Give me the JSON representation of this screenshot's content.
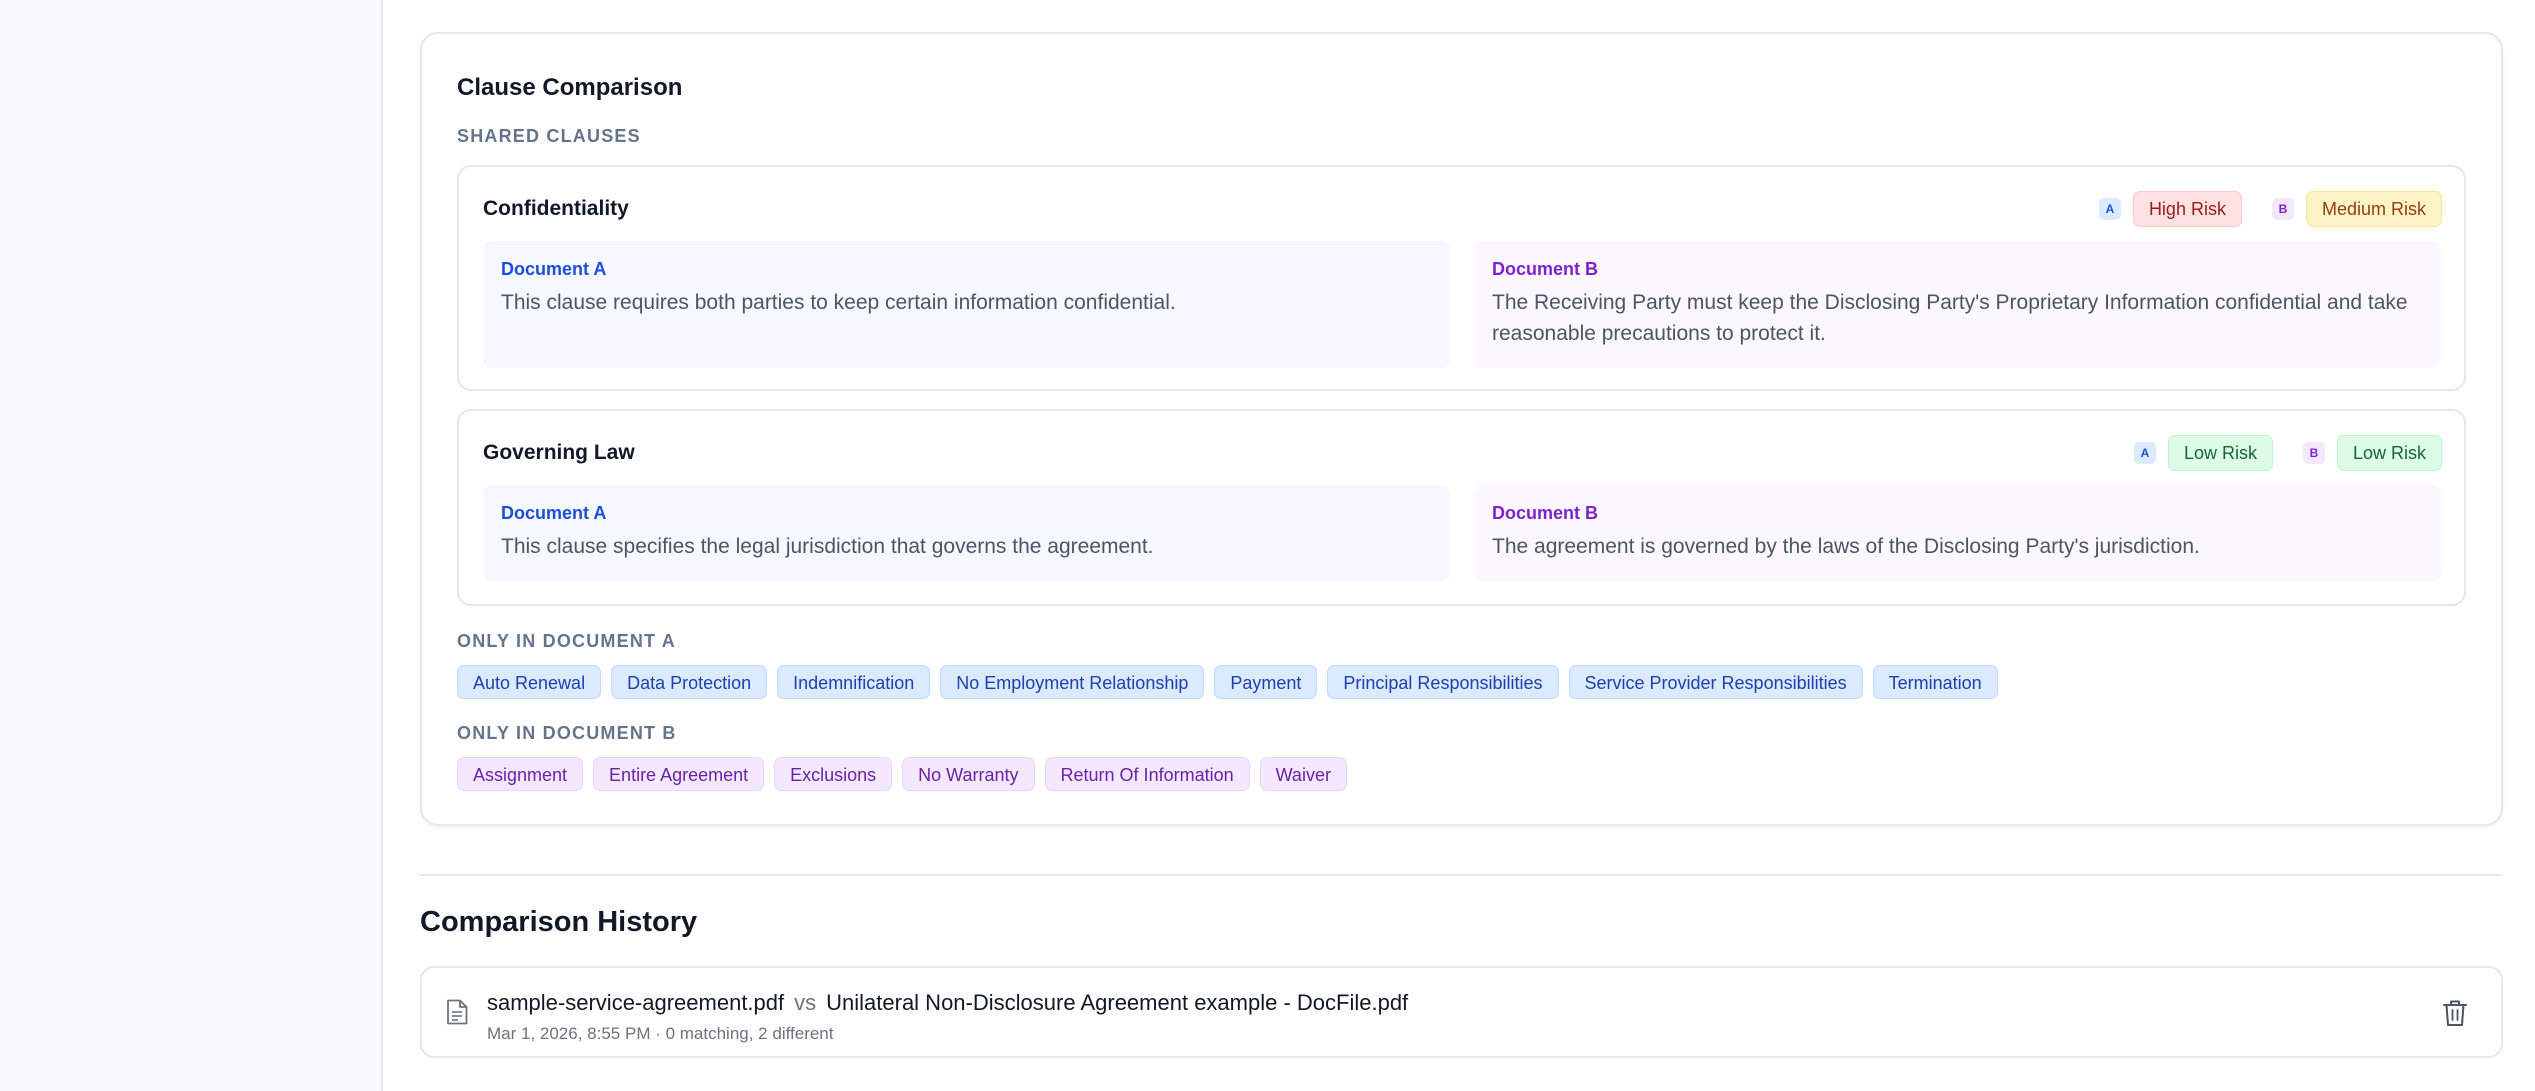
{
  "clause_comparison": {
    "title": "Clause Comparison",
    "shared_label": "SHARED CLAUSES",
    "doc_a_letter": "A",
    "doc_b_letter": "B",
    "shared_clauses": [
      {
        "name": "Confidentiality",
        "risk_a": "High Risk",
        "risk_b": "Medium Risk",
        "doc_a_label": "Document A",
        "doc_a_text": "This clause requires both parties to keep certain information confidential.",
        "doc_b_label": "Document B",
        "doc_b_text": "The Receiving Party must keep the Disclosing Party's Proprietary Information confidential and take reasonable precautions to protect it."
      },
      {
        "name": "Governing Law",
        "risk_a": "Low Risk",
        "risk_b": "Low Risk",
        "doc_a_label": "Document A",
        "doc_a_text": "This clause specifies the legal jurisdiction that governs the agreement.",
        "doc_b_label": "Document B",
        "doc_b_text": "The agreement is governed by the laws of the Disclosing Party's jurisdiction."
      }
    ],
    "only_a_label": "ONLY IN DOCUMENT A",
    "only_a": [
      "Auto Renewal",
      "Data Protection",
      "Indemnification",
      "No Employment Relationship",
      "Payment",
      "Principal Responsibilities",
      "Service Provider Responsibilities",
      "Termination"
    ],
    "only_b_label": "ONLY IN DOCUMENT B",
    "only_b": [
      "Assignment",
      "Entire Agreement",
      "Exclusions",
      "No Warranty",
      "Return Of Information",
      "Waiver"
    ]
  },
  "history": {
    "title": "Comparison History",
    "items": [
      {
        "doc_a": "sample-service-agreement.pdf",
        "vs": "vs",
        "doc_b": "Unilateral Non-Disclosure Agreement example - DocFile.pdf",
        "meta": "Mar 1, 2026, 8:55 PM · 0 matching, 2 different",
        "icon": "document-icon",
        "delete_icon": "trash-icon"
      }
    ]
  },
  "colors": {
    "doc_a_accent": "#1d4ed8",
    "doc_b_accent": "#7e22ce",
    "high_risk": "#991b1b",
    "medium_risk": "#92400e",
    "low_risk": "#166534"
  }
}
